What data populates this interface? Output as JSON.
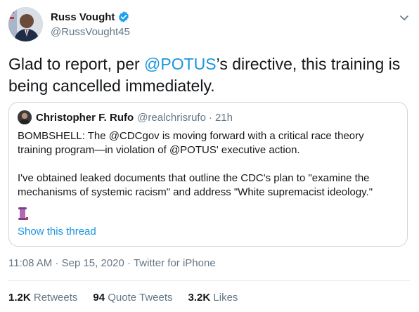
{
  "author": {
    "display_name": "Russ Vought",
    "handle": "@RussVought45"
  },
  "tweet": {
    "text_before": "Glad to report, per ",
    "mention": "@POTUS",
    "text_after": "’s directive, this training is being cancelled immediately."
  },
  "quoted": {
    "display_name": "Christopher F. Rufo",
    "handle": "@realchrisrufo",
    "separator": "·",
    "age": "21h",
    "paragraph1": "BOMBSHELL: The @CDCgov is moving forward with a critical race theory training program—in violation of @POTUS' executive action.",
    "paragraph2": "I've obtained leaked documents that outline the CDC's plan to \"examine the mechanisms of systemic racism\" and address \"White supremacist ideology.\"",
    "show_thread": "Show this thread"
  },
  "meta": {
    "time": "11:08 AM",
    "dot1": "·",
    "date": "Sep 15, 2020",
    "dot2": "·",
    "source": "Twitter for iPhone"
  },
  "stats": {
    "retweets_count": "1.2K",
    "retweets_label": "Retweets",
    "quotes_count": "94",
    "quotes_label": "Quote Tweets",
    "likes_count": "3.2K",
    "likes_label": "Likes"
  },
  "colors": {
    "link": "#1b95e0",
    "muted": "#657786",
    "border": "#ccd6dd"
  },
  "icons": {
    "verified": "verified-badge-icon",
    "menu": "chevron-down-icon",
    "emoji": "scroll-emoji-icon"
  }
}
